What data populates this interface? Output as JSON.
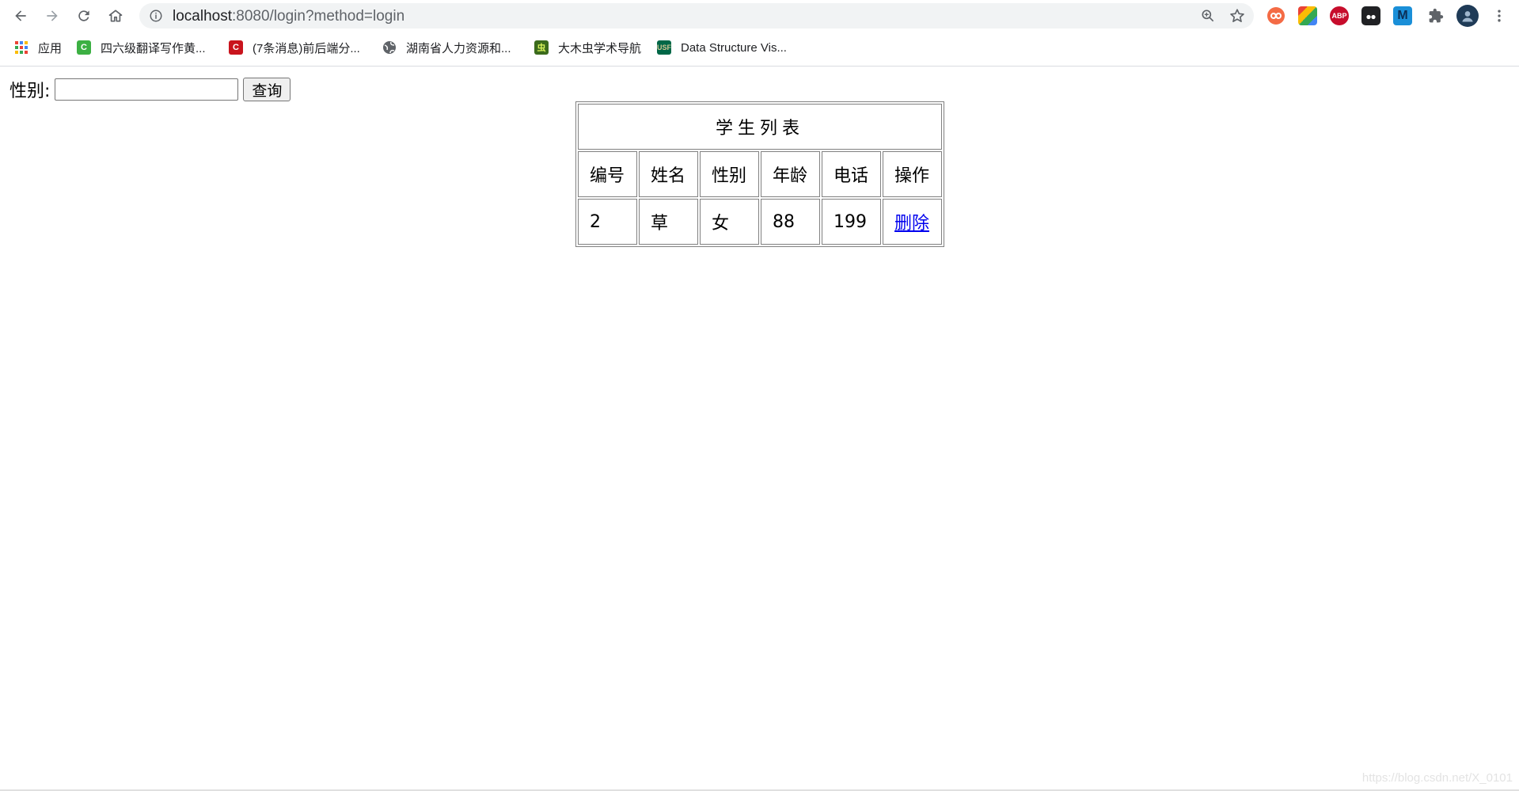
{
  "browser": {
    "url_host": "localhost",
    "url_rest": ":8080/login?method=login",
    "nav": {
      "back_icon": "arrow-left-icon",
      "forward_icon": "arrow-right-icon",
      "reload_icon": "reload-icon",
      "home_icon": "home-icon"
    },
    "extensions": [
      {
        "name": "infinity-extension-icon",
        "label": "∞",
        "color": "#e8453c"
      },
      {
        "name": "colorful-extension-icon",
        "label": "",
        "color": "#34a853"
      },
      {
        "name": "adblock-plus-icon",
        "label": "ABP",
        "color": "#c70d2c"
      },
      {
        "name": "tampermonkey-icon",
        "label": "",
        "color": "#202124"
      },
      {
        "name": "m-extension-icon",
        "label": "M",
        "color": "#1a8fd8"
      }
    ],
    "bookmarks": [
      {
        "label": "应用",
        "icon": "apps-grid-icon"
      },
      {
        "label": "四六级翻译写作黄...",
        "icon": "green-c-icon",
        "color": "#3cb043"
      },
      {
        "label": "(7条消息)前后端分...",
        "icon": "csdn-icon",
        "color": "#c9141d"
      },
      {
        "label": "湖南省人力资源和...",
        "icon": "globe-icon"
      },
      {
        "label": "大木虫学术导航",
        "icon": "damuchong-icon",
        "color": "#3b6b1c"
      },
      {
        "label": "Data Structure Vis...",
        "icon": "usf-icon",
        "color": "#006747"
      }
    ]
  },
  "form": {
    "label": "性别:",
    "input_value": "",
    "button_label": "查询"
  },
  "table": {
    "caption": "学生列表",
    "headers": [
      "编号",
      "姓名",
      "性别",
      "年龄",
      "电话",
      "操作"
    ],
    "rows": [
      {
        "id": "2",
        "name": "草",
        "gender": "女",
        "age": "88",
        "phone": "199",
        "action": "删除"
      }
    ]
  },
  "watermark": "https://blog.csdn.net/X_0101"
}
